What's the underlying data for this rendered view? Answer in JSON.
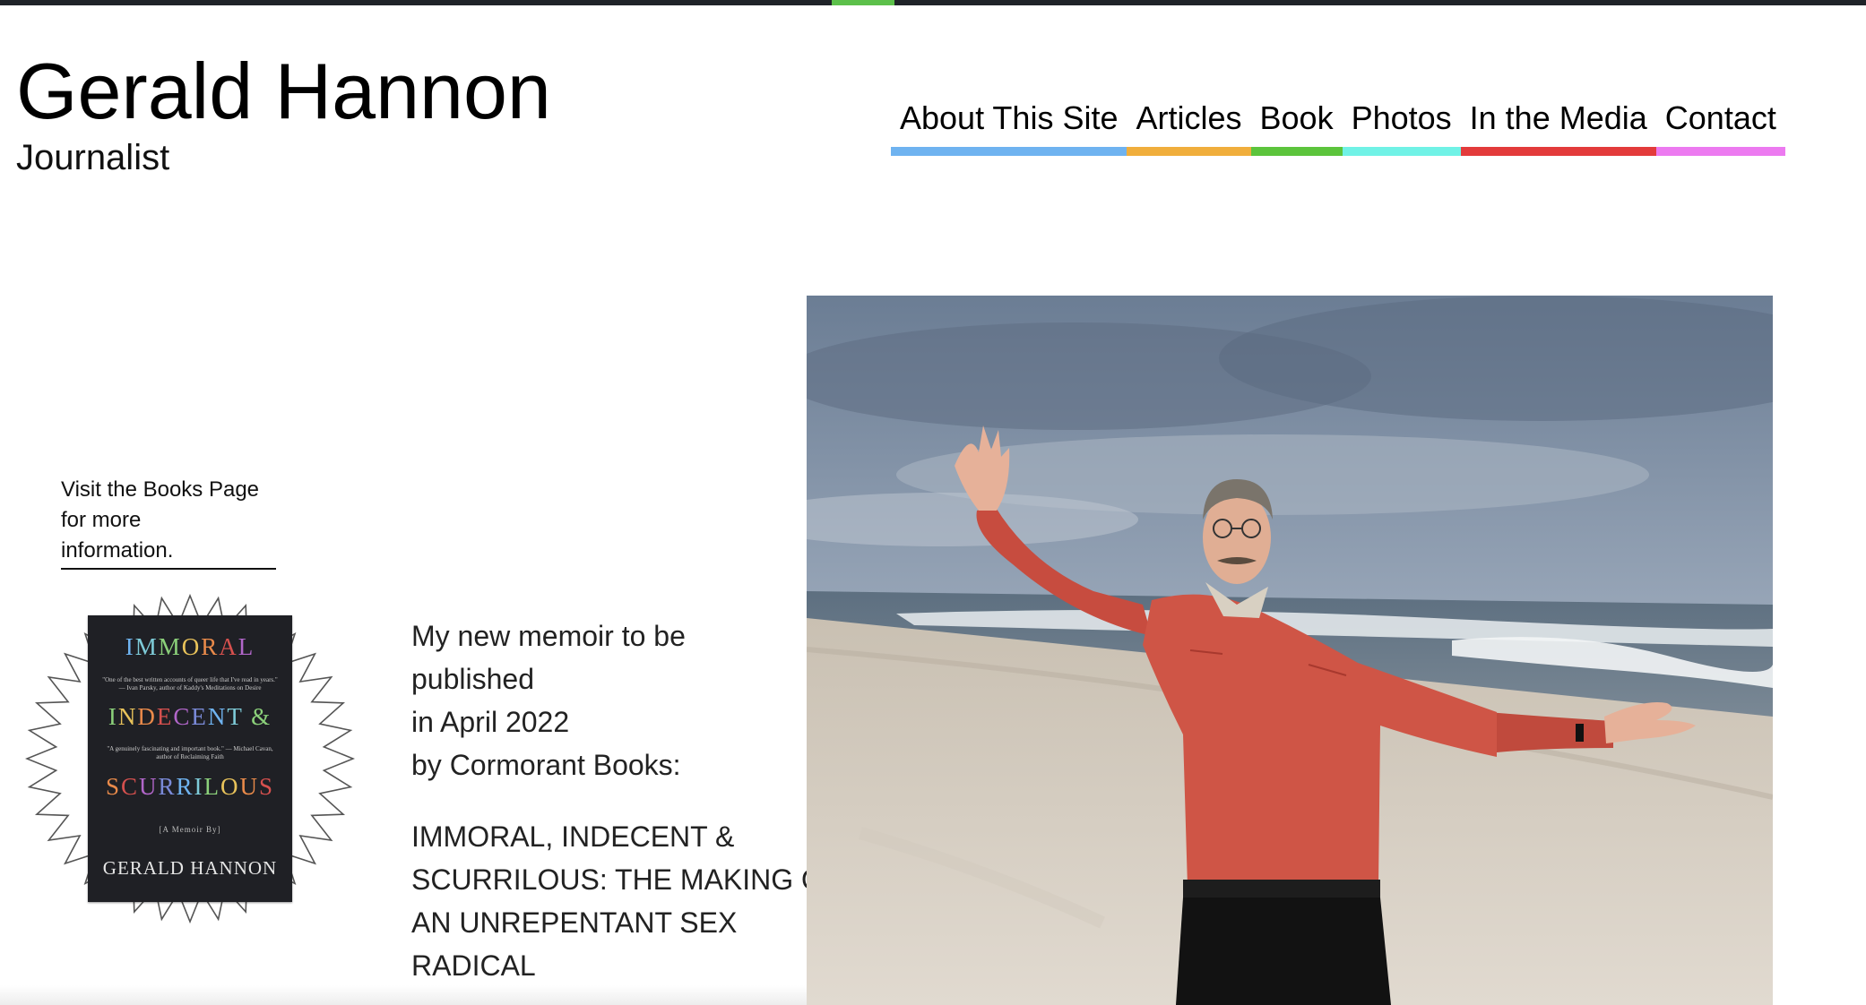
{
  "site": {
    "title": "Gerald Hannon",
    "subtitle": "Journalist"
  },
  "nav": [
    {
      "label": "About This Site",
      "color": "#6fb3f0"
    },
    {
      "label": "Articles",
      "color": "#f0ae3c"
    },
    {
      "label": "Book",
      "color": "#5cc43c"
    },
    {
      "label": "Photos",
      "color": "#70f2e6"
    },
    {
      "label": "In the Media",
      "color": "#e33b3b"
    },
    {
      "label": "Contact",
      "color": "#ec7af0"
    }
  ],
  "sidebar": {
    "books_link_lines": [
      "Visit the Books Page",
      "for more",
      "information."
    ]
  },
  "book_cover": {
    "words": [
      "IMMORAL",
      "INDECENT &",
      "SCURRILOUS"
    ],
    "quote1": "\"One of the best written accounts of queer life that I've read in years.\" — Ivan Parsky, author of Kaddy's Meditations on Desire",
    "quote2": "\"A genuinely fascinating and important book.\" — Michael Cavan, author of Reclaiming Faith",
    "tag": "[A Memoir By]",
    "author": "GERALD HANNON"
  },
  "memoir": {
    "intro_lines": [
      "My new memoir to be",
      "published",
      "in April 2022",
      "by Cormorant Books:"
    ],
    "title_lines": [
      "IMMORAL, INDECENT &",
      "SCURRILOUS: THE MAKING OF",
      "AN UNREPENTANT SEX",
      "RADICAL"
    ]
  }
}
